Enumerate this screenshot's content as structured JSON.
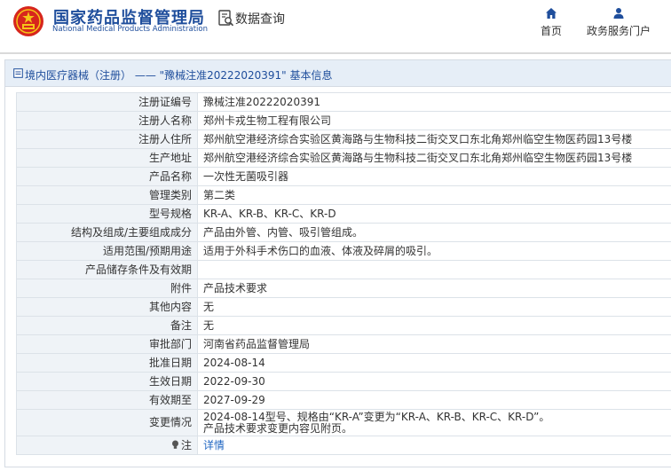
{
  "header": {
    "org_name_cn": "国家药品监督管理局",
    "org_name_en": "National Medical Products Administration",
    "query_label": "数据查询",
    "nav": {
      "home_label": "首页",
      "portal_label": "政务服务门户"
    },
    "brand_color": "#1f4e9c",
    "emblem_color": "#d7261d"
  },
  "breadcrumb": {
    "text": "境内医疗器械（注册） —— \"豫械注准20222020391\" 基本信息"
  },
  "fields": [
    {
      "label": "注册证编号",
      "value": "豫械注准20222020391"
    },
    {
      "label": "注册人名称",
      "value": "郑州卡戎生物工程有限公司"
    },
    {
      "label": "注册人住所",
      "value": "郑州航空港经济综合实验区黄海路与生物科技二街交叉口东北角郑州临空生物医药园13号楼"
    },
    {
      "label": "生产地址",
      "value": "郑州航空港经济综合实验区黄海路与生物科技二街交叉口东北角郑州临空生物医药园13号楼"
    },
    {
      "label": "产品名称",
      "value": "一次性无菌吸引器"
    },
    {
      "label": "管理类别",
      "value": "第二类"
    },
    {
      "label": "型号规格",
      "value": "KR-A、KR-B、KR-C、KR-D"
    },
    {
      "label": "结构及组成/主要组成成分",
      "value": "产品由外管、内管、吸引管组成。"
    },
    {
      "label": "适用范围/预期用途",
      "value": "适用于外科手术伤口的血液、体液及碎屑的吸引。"
    },
    {
      "label": "产品储存条件及有效期",
      "value": ""
    },
    {
      "label": "附件",
      "value": "产品技术要求"
    },
    {
      "label": "其他内容",
      "value": "无"
    },
    {
      "label": "备注",
      "value": "无"
    },
    {
      "label": "审批部门",
      "value": "河南省药品监督管理局"
    },
    {
      "label": "批准日期",
      "value": "2024-08-14"
    },
    {
      "label": "生效日期",
      "value": "2022-09-30"
    },
    {
      "label": "有效期至",
      "value": "2027-09-29"
    },
    {
      "label": "变更情况",
      "value_line1": "2024-08-14型号、规格由“KR-A”变更为“KR-A、KR-B、KR-C、KR-D”。",
      "value_line2": "产品技术要求变更内容见附页。"
    },
    {
      "label": "注",
      "value": "详情"
    }
  ]
}
